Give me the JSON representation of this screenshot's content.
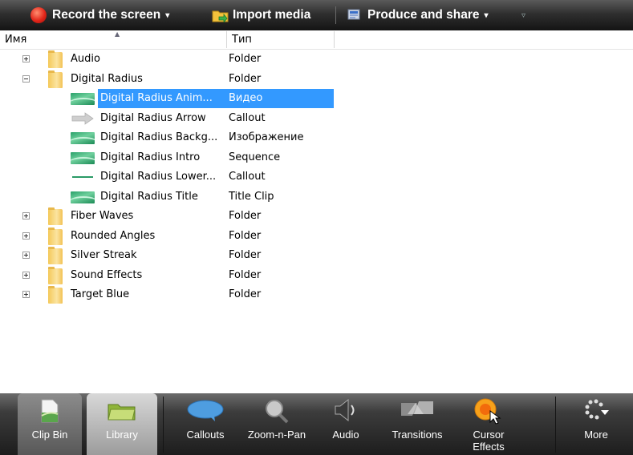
{
  "toolbar": {
    "record_label": "Record the screen",
    "import_label": "Import media",
    "produce_label": "Produce and share",
    "caret": "▾",
    "overflow": "▿"
  },
  "columns": {
    "name": "Имя",
    "type": "Тип",
    "sort_glyph": "▲"
  },
  "rows": [
    {
      "name": "Audio",
      "type": "Folder",
      "icon": "folder-icon",
      "expander": "plus"
    },
    {
      "name": "Digital Radius",
      "type": "Folder",
      "icon": "folder-icon",
      "expander": "minus"
    },
    {
      "name": "Digital Radius Anim...",
      "type": "Видео",
      "icon": "video-clip-icon",
      "selected": true
    },
    {
      "name": "Digital Radius Arrow",
      "type": "Callout",
      "icon": "arrow-callout-icon"
    },
    {
      "name": "Digital Radius Backg...",
      "type": "Изображение",
      "icon": "image-icon"
    },
    {
      "name": "Digital Radius Intro",
      "type": "Sequence",
      "icon": "sequence-icon"
    },
    {
      "name": "Digital Radius Lower...",
      "type": "Callout",
      "icon": "line-callout-icon"
    },
    {
      "name": "Digital Radius Title",
      "type": "Title Clip",
      "icon": "title-clip-icon"
    },
    {
      "name": "Fiber Waves",
      "type": "Folder",
      "icon": "folder-icon",
      "expander": "plus"
    },
    {
      "name": "Rounded Angles",
      "type": "Folder",
      "icon": "folder-icon",
      "expander": "plus"
    },
    {
      "name": "Silver Streak",
      "type": "Folder",
      "icon": "folder-icon",
      "expander": "plus"
    },
    {
      "name": "Sound Effects",
      "type": "Folder",
      "icon": "folder-icon",
      "expander": "plus"
    },
    {
      "name": "Target Blue",
      "type": "Folder",
      "icon": "folder-icon",
      "expander": "plus"
    }
  ],
  "tabs": [
    {
      "label": "Clip Bin",
      "icon": "clip-bin-icon"
    },
    {
      "label": "Library",
      "icon": "library-icon",
      "active": true
    },
    {
      "label": "Callouts",
      "icon": "callout-bubble-icon"
    },
    {
      "label": "Zoom-n-Pan",
      "icon": "magnifier-icon"
    },
    {
      "label": "Audio",
      "icon": "speaker-icon"
    },
    {
      "label": "Transitions",
      "icon": "transitions-icon"
    },
    {
      "label": "Cursor Effects",
      "icon": "cursor-effects-icon"
    },
    {
      "label": "More",
      "icon": "more-icon"
    }
  ],
  "colors": {
    "selection": "#3399ff",
    "record": "#e3261a",
    "toolbar": "#2f2f2f"
  }
}
